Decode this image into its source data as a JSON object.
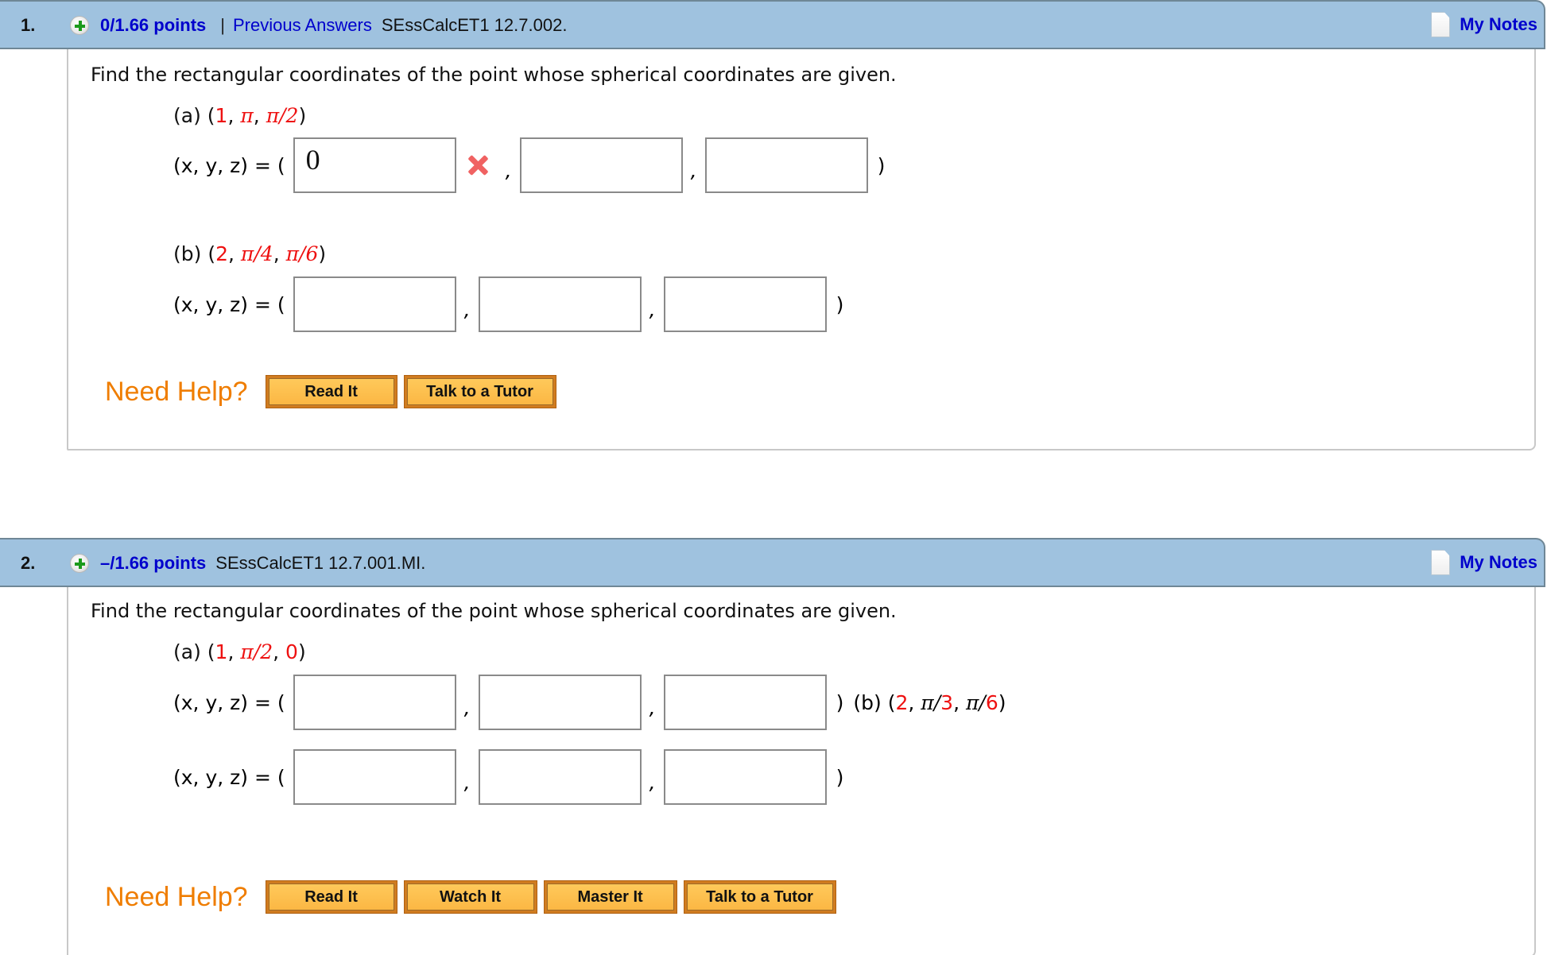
{
  "questions": [
    {
      "number": "1.",
      "points": "0/1.66 points",
      "separator": "|",
      "previous_answers": "Previous Answers",
      "code": "SEssCalcET1 12.7.002.",
      "notes_label": "My Notes",
      "prompt": "Find the rectangular coordinates of the point whose spherical coordinates are given.",
      "parts": [
        {
          "label": "(a)",
          "point": {
            "open": "(",
            "rho": "1",
            "theta": "π",
            "phi": "π/2",
            "close": ")"
          },
          "lhs": "(x, y, z) = (",
          "answers": [
            {
              "value": "0",
              "status": "incorrect"
            },
            {
              "value": ""
            },
            {
              "value": ""
            }
          ],
          "rhs": ")"
        },
        {
          "label": "(b)",
          "point": {
            "open": "(",
            "rho": "2",
            "theta": "π/4",
            "phi": "π/6",
            "close": ")"
          },
          "lhs": "(x, y, z) = (",
          "answers": [
            {
              "value": ""
            },
            {
              "value": ""
            },
            {
              "value": ""
            }
          ],
          "rhs": ")"
        }
      ],
      "help": {
        "label": "Need Help?",
        "buttons": [
          "Read It",
          "Talk to a Tutor"
        ]
      }
    },
    {
      "number": "2.",
      "points": "–/1.66 points",
      "code": "SEssCalcET1 12.7.001.MI.",
      "notes_label": "My Notes",
      "prompt": "Find the rectangular coordinates of the point whose spherical coordinates are given.",
      "parts": [
        {
          "label": "(a)",
          "point": {
            "open": "(",
            "rho": "1",
            "theta": "π/2",
            "phi": "0",
            "close": ")"
          },
          "lhs": "(x, y, z) = (",
          "answers": [
            {
              "value": ""
            },
            {
              "value": ""
            },
            {
              "value": ""
            }
          ],
          "rhs": ")"
        },
        {
          "label": "(b)",
          "point": {
            "open": "(",
            "rho": "2",
            "theta_pi": "π/",
            "theta_den": "3",
            "phi_pi": "π/",
            "phi_den": "6",
            "close": ")"
          },
          "lhs": "(x, y, z) = (",
          "answers": [
            {
              "value": ""
            },
            {
              "value": ""
            },
            {
              "value": ""
            }
          ],
          "rhs": ")"
        }
      ],
      "help": {
        "label": "Need Help?",
        "buttons": [
          "Read It",
          "Watch It",
          "Master It",
          "Talk to a Tutor"
        ]
      }
    }
  ],
  "comma": ",",
  "colors": {
    "header_bg": "#9fc2df",
    "link_blue": "#0000cc",
    "given_red": "#ee1111",
    "help_orange": "#ef7d00",
    "button_fill": "#fbb744",
    "wrong_mark": "#f06262"
  }
}
